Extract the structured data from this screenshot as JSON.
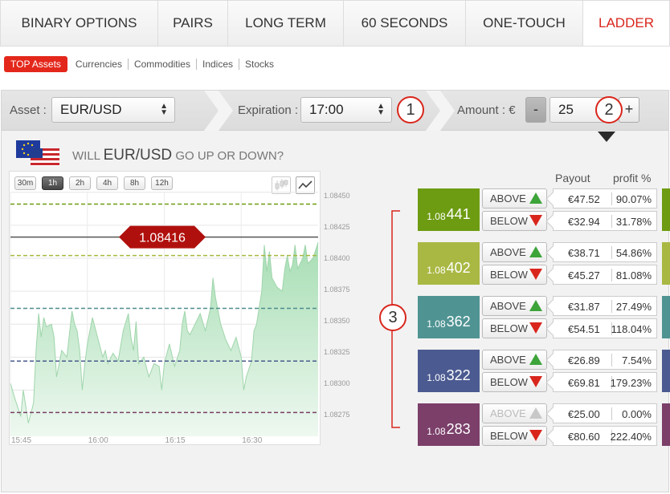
{
  "tabs": [
    {
      "label": "BINARY OPTIONS",
      "active": false
    },
    {
      "label": "PAIRS",
      "active": false
    },
    {
      "label": "LONG TERM",
      "active": false
    },
    {
      "label": "60 SECONDS",
      "active": false
    },
    {
      "label": "ONE-TOUCH",
      "active": false
    },
    {
      "label": "LADDER",
      "active": true
    }
  ],
  "subnav": [
    "TOP Assets",
    "Currencies",
    "Commodities",
    "Indices",
    "Stocks"
  ],
  "controls": {
    "asset_label": "Asset :",
    "asset_value": "EUR/USD",
    "expiration_label": "Expiration :",
    "expiration_value": "17:00",
    "amount_label": "Amount : €",
    "minus": "-",
    "amount_value": "25",
    "plus": "+"
  },
  "badges": [
    "1",
    "2",
    "3"
  ],
  "heading": {
    "pre": "WILL",
    "asset": "EUR/USD",
    "post": "GO UP OR DOWN?"
  },
  "chart": {
    "timeframes": [
      "30m",
      "1h",
      "2h",
      "4h",
      "8h",
      "12h"
    ],
    "active_timeframe": "1h",
    "current_price": "1.08416",
    "y_ticks": [
      "1.08450",
      "1.08425",
      "1.08400",
      "1.08375",
      "1.08350",
      "1.08325",
      "1.08300",
      "1.08275"
    ],
    "x_ticks": [
      "15:45",
      "16:00",
      "16:15",
      "16:30"
    ]
  },
  "chart_data": {
    "type": "area",
    "ylim": [
      1.08265,
      1.08462
    ],
    "xlim": [
      0,
      120
    ],
    "x_ticks": [
      {
        "label": "15:45",
        "x": 0
      },
      {
        "label": "16:00",
        "x": 30
      },
      {
        "label": "16:15",
        "x": 60
      },
      {
        "label": "16:30",
        "x": 90
      }
    ],
    "y_ticks": [
      1.0845,
      1.08425,
      1.084,
      1.08375,
      1.0835,
      1.08325,
      1.083,
      1.08275
    ],
    "current_price": 1.08416,
    "series": [
      {
        "values": [
          [
            0,
            1.08305
          ],
          [
            2,
            1.08292
          ],
          [
            4,
            1.0828
          ],
          [
            5,
            1.083
          ],
          [
            7,
            1.08275
          ],
          [
            9,
            1.0829
          ],
          [
            10,
            1.0833
          ],
          [
            11,
            1.08358
          ],
          [
            12,
            1.0834
          ],
          [
            13,
            1.08355
          ],
          [
            14,
            1.08348
          ],
          [
            16,
            1.0835
          ],
          [
            17,
            1.0834
          ],
          [
            18,
            1.0831
          ],
          [
            20,
            1.0833
          ],
          [
            22,
            1.08325
          ],
          [
            24,
            1.0836
          ],
          [
            25,
            1.0835
          ],
          [
            26,
            1.08345
          ],
          [
            27,
            1.0833
          ],
          [
            28,
            1.083
          ],
          [
            29,
            1.0832
          ],
          [
            30,
            1.08335
          ],
          [
            31,
            1.08345
          ],
          [
            32,
            1.08355
          ],
          [
            34,
            1.0834
          ],
          [
            36,
            1.08325
          ],
          [
            37,
            1.0833
          ],
          [
            38,
            1.0832
          ],
          [
            40,
            1.08328
          ],
          [
            42,
            1.08322
          ],
          [
            44,
            1.08345
          ],
          [
            46,
            1.08358
          ],
          [
            47,
            1.0834
          ],
          [
            48,
            1.0833
          ],
          [
            49,
            1.08352
          ],
          [
            50,
            1.0832
          ],
          [
            52,
            1.08325
          ],
          [
            54,
            1.0831
          ],
          [
            56,
            1.0832
          ],
          [
            58,
            1.08318
          ],
          [
            59,
            1.083
          ],
          [
            60,
            1.0832
          ],
          [
            62,
            1.08335
          ],
          [
            64,
            1.08318
          ],
          [
            66,
            1.0833
          ],
          [
            67,
            1.0835
          ],
          [
            68,
            1.0836
          ],
          [
            69,
            1.08345
          ],
          [
            70,
            1.08342
          ],
          [
            72,
            1.0835
          ],
          [
            74,
            1.08358
          ],
          [
            76,
            1.08345
          ],
          [
            78,
            1.08362
          ],
          [
            79,
            1.08385
          ],
          [
            80,
            1.0837
          ],
          [
            82,
            1.0835
          ],
          [
            84,
            1.08338
          ],
          [
            86,
            1.0833
          ],
          [
            88,
            1.0834
          ],
          [
            90,
            1.08325
          ],
          [
            91,
            1.083
          ],
          [
            92,
            1.0831
          ],
          [
            94,
            1.08322
          ],
          [
            95,
            1.08345
          ],
          [
            96,
            1.0835
          ],
          [
            98,
            1.08375
          ],
          [
            99,
            1.0841
          ],
          [
            100,
            1.0839
          ],
          [
            101,
            1.08405
          ],
          [
            102,
            1.08385
          ],
          [
            104,
            1.08378
          ],
          [
            106,
            1.08375
          ],
          [
            107,
            1.08392
          ],
          [
            108,
            1.08402
          ],
          [
            109,
            1.0839
          ],
          [
            110,
            1.08395
          ],
          [
            111,
            1.0841
          ],
          [
            112,
            1.08392
          ],
          [
            114,
            1.084
          ],
          [
            115,
            1.0841
          ],
          [
            116,
            1.08396
          ],
          [
            118,
            1.084
          ],
          [
            120,
            1.08412
          ]
        ]
      }
    ],
    "reference_lines": [
      {
        "value": 1.08441,
        "color": "#6e9b12"
      },
      {
        "value": 1.08416,
        "color": "#555555"
      },
      {
        "value": 1.08402,
        "color": "#a8b83e"
      },
      {
        "value": 1.08362,
        "color": "#4d8e8c"
      },
      {
        "value": 1.08322,
        "color": "#4a5a8c"
      },
      {
        "value": 1.08283,
        "color": "#7a3e64"
      }
    ]
  },
  "payout_header": {
    "payout": "Payout",
    "profit": "profit %"
  },
  "ladder": [
    {
      "small": "1.08",
      "big": "441",
      "color": "#6d9c12",
      "above": {
        "label": "ABOVE",
        "payout": "€47.52",
        "profit": "90.07%",
        "enabled": true
      },
      "below": {
        "label": "BELOW",
        "payout": "€32.94",
        "profit": "31.78%",
        "enabled": true
      }
    },
    {
      "small": "1.08",
      "big": "402",
      "color": "#a9b843",
      "above": {
        "label": "ABOVE",
        "payout": "€38.71",
        "profit": "54.86%",
        "enabled": true
      },
      "below": {
        "label": "BELOW",
        "payout": "€45.27",
        "profit": "81.08%",
        "enabled": true
      }
    },
    {
      "small": "1.08",
      "big": "362",
      "color": "#4f9493",
      "above": {
        "label": "ABOVE",
        "payout": "€31.87",
        "profit": "27.49%",
        "enabled": true
      },
      "below": {
        "label": "BELOW",
        "payout": "€54.51",
        "profit": "118.04%",
        "enabled": true
      }
    },
    {
      "small": "1.08",
      "big": "322",
      "color": "#4b5b91",
      "above": {
        "label": "ABOVE",
        "payout": "€26.89",
        "profit": "7.54%",
        "enabled": true
      },
      "below": {
        "label": "BELOW",
        "payout": "€69.81",
        "profit": "179.23%",
        "enabled": true
      }
    },
    {
      "small": "1.08",
      "big": "283",
      "color": "#7b3f6a",
      "above": {
        "label": "ABOVE",
        "payout": "€25.00",
        "profit": "0.00%",
        "enabled": false
      },
      "below": {
        "label": "BELOW",
        "payout": "€80.60",
        "profit": "222.40%",
        "enabled": true
      }
    }
  ],
  "colors": {
    "accent": "#d9261c",
    "up": "#3da43a",
    "down": "#d9261c",
    "disabled": "#c8c8c8"
  }
}
